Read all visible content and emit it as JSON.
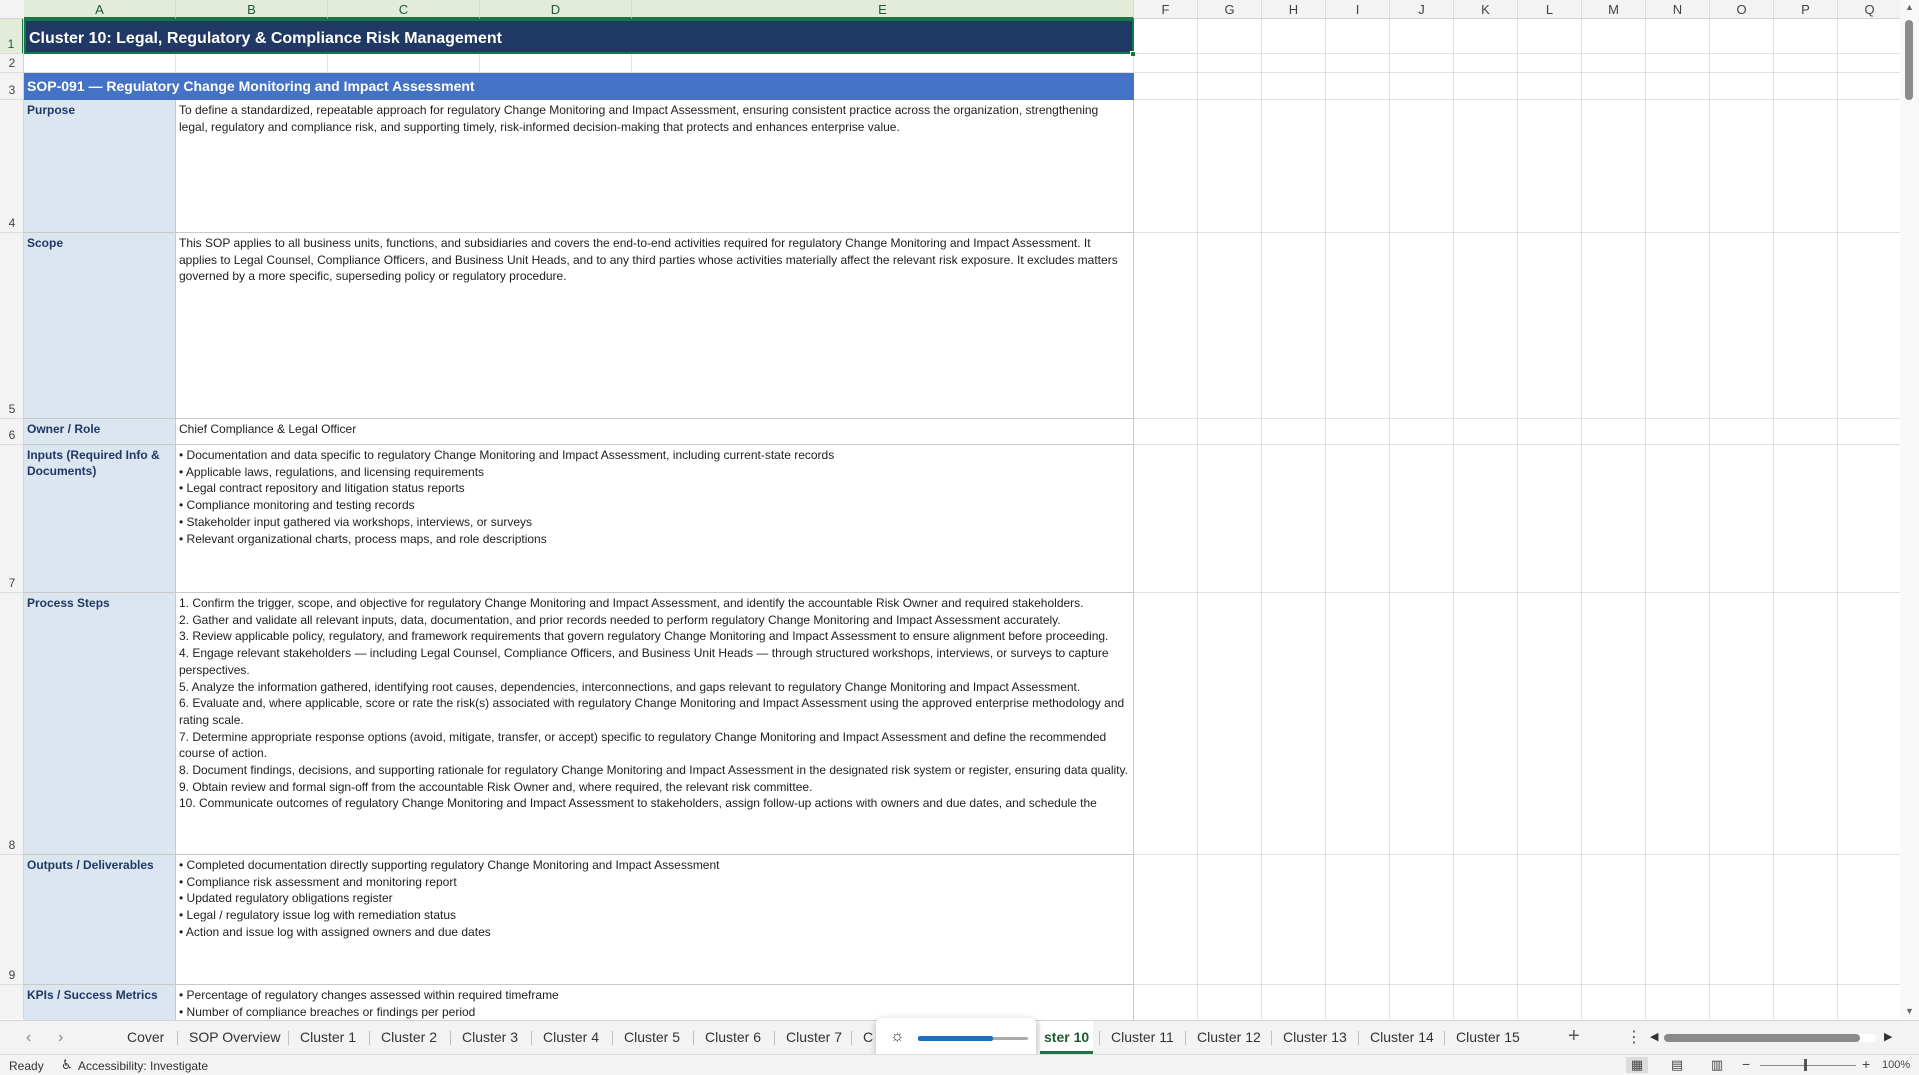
{
  "columns": [
    "A",
    "B",
    "C",
    "D",
    "E",
    "F",
    "G",
    "H",
    "I",
    "J",
    "K",
    "L",
    "M",
    "N",
    "O",
    "P",
    "Q"
  ],
  "rows": [
    "1",
    "2",
    "3",
    "4",
    "5",
    "6",
    "7",
    "8",
    "9"
  ],
  "sheet": {
    "title": "Cluster 10: Legal, Regulatory & Compliance Risk Management",
    "sop_header": "SOP-091  —  Regulatory Change Monitoring and Impact Assessment",
    "sections": [
      {
        "label": "Purpose",
        "lines": [
          "To define a standardized, repeatable approach for regulatory Change Monitoring and Impact Assessment, ensuring consistent practice across the organization, strengthening legal, regulatory and compliance risk, and supporting timely, risk-informed decision-making that protects and enhances enterprise value."
        ]
      },
      {
        "label": "Scope",
        "lines": [
          "This SOP applies to all business units, functions, and subsidiaries and covers the end-to-end activities required for regulatory Change Monitoring and Impact Assessment. It applies to Legal Counsel, Compliance Officers, and Business Unit Heads, and to any third parties whose activities materially affect the relevant risk exposure. It excludes matters governed by a more specific, superseding policy or regulatory procedure."
        ]
      },
      {
        "label": "Owner / Role",
        "lines": [
          "Chief Compliance & Legal Officer"
        ]
      },
      {
        "label": "Inputs (Required Info & Documents)",
        "lines": [
          "• Documentation and data specific to regulatory Change Monitoring and Impact Assessment, including current-state records",
          "• Applicable laws, regulations, and licensing requirements",
          "• Legal contract repository and litigation status reports",
          "• Compliance monitoring and testing records",
          "• Stakeholder input gathered via workshops, interviews, or surveys",
          "• Relevant organizational charts, process maps, and role descriptions"
        ]
      },
      {
        "label": "Process Steps",
        "lines": [
          "1. Confirm the trigger, scope, and objective for regulatory Change Monitoring and Impact Assessment, and identify the accountable Risk Owner and required stakeholders.",
          "2. Gather and validate all relevant inputs, data, documentation, and prior records needed to perform regulatory Change Monitoring and Impact Assessment accurately.",
          "3. Review applicable policy, regulatory, and framework requirements that govern regulatory Change Monitoring and Impact Assessment to ensure alignment before proceeding.",
          "4. Engage relevant stakeholders — including Legal Counsel, Compliance Officers, and Business Unit Heads — through structured workshops, interviews, or surveys to capture perspectives.",
          "5. Analyze the information gathered, identifying root causes, dependencies, interconnections, and gaps relevant to regulatory Change Monitoring and Impact Assessment.",
          "6. Evaluate and, where applicable, score or rate the risk(s) associated with regulatory Change Monitoring and Impact Assessment using the approved enterprise methodology and rating scale.",
          "7. Determine appropriate response options (avoid, mitigate, transfer, or accept) specific to regulatory Change Monitoring and Impact Assessment and define the recommended course of action.",
          "8. Document findings, decisions, and supporting rationale for regulatory Change Monitoring and Impact Assessment in the designated risk system or register, ensuring data quality.",
          "9. Obtain review and formal sign-off from the accountable Risk Owner and, where required, the relevant risk committee.",
          "10. Communicate outcomes of regulatory Change Monitoring and Impact Assessment to stakeholders, assign follow-up actions with owners and due dates, and schedule the"
        ]
      },
      {
        "label": "Outputs / Deliverables",
        "lines": [
          "• Completed documentation directly supporting regulatory Change Monitoring and Impact Assessment",
          "• Compliance risk assessment and monitoring report",
          "• Updated regulatory obligations register",
          "• Legal / regulatory issue log with remediation status",
          "• Action and issue log with assigned owners and due dates"
        ]
      },
      {
        "label": "KPIs / Success Metrics",
        "lines": [
          "• Percentage of regulatory changes assessed within required timeframe",
          "• Number of compliance breaches or findings per period"
        ]
      }
    ]
  },
  "tabs": {
    "items": [
      "Cover",
      "SOP Overview",
      "Cluster 1",
      "Cluster 2",
      "Cluster 3",
      "Cluster 4",
      "Cluster 5",
      "Cluster 6",
      "Cluster 7",
      "C",
      "ster 10",
      "Cluster 11",
      "Cluster 12",
      "Cluster 13",
      "Cluster 14",
      "Cluster 15"
    ],
    "active": "ster 10",
    "add": "+",
    "menu": "⋮",
    "prev": "‹",
    "next": "›"
  },
  "brightness": {
    "icon": "sun-icon",
    "level": 0.68
  },
  "status": {
    "ready": "Ready",
    "accessibility": "Accessibility: Investigate",
    "zoom": "100%"
  },
  "colors": {
    "title_bg": "#1f3864",
    "sop_bg": "#4472c4",
    "label_bg": "#dce6f1",
    "accent": "#217346"
  }
}
